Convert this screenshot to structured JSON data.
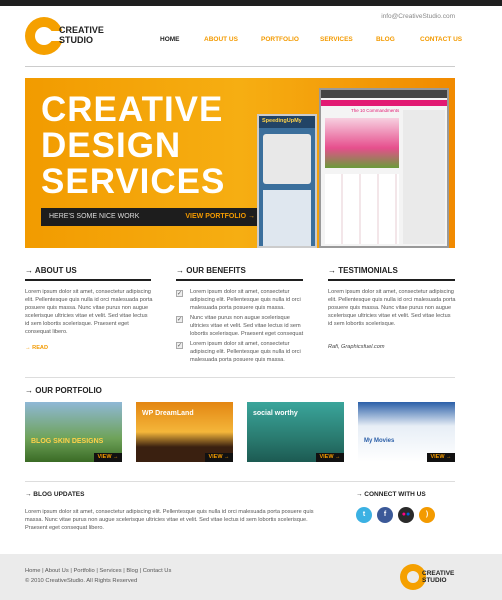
{
  "header": {
    "email": "info@CreativeStudio.com",
    "logo_line1": "CREATIVE",
    "logo_line2": "STUDIO",
    "nav": [
      "HOME",
      "ABOUT US",
      "PORTFOLIO",
      "SERVICES",
      "BLOG",
      "CONTACT US"
    ]
  },
  "hero": {
    "title_line1": "CREATIVE",
    "title_line2": "DESIGN",
    "title_line3": "SERVICES",
    "tagline": "HERE'S SOME NICE WORK",
    "cta": "VIEW PORTFOLIO →",
    "shot1_title": "SpeedingUpMy",
    "shot2_title": "The 10 Commandments"
  },
  "about": {
    "title": "→  ABOUT US",
    "text": "Lorem ipsum dolor sit amet, consectetur adipiscing elit. Pellentesque quis nulla id orci malesuada porta posuere quis massa. Nunc vitae purus non augue scelerisque ultricies vitae et velit. Sed vitae lectus id sem lobortis scelerisque. Praesent eget consequat libero.",
    "read": "→  READ"
  },
  "benefits": {
    "title": "→  OUR BENEFITS",
    "items": [
      "Lorem ipsum dolor sit amet, consectetur adipiscing elit. Pellentesque quis nulla id orci malesuada porta posuere quis massa.",
      "Nunc vitae purus non augue scelerisque ultricies vitae et velit. Sed vitae lectus id sem lobortis scelerisque. Praesent eget consequat",
      "Lorem ipsum dolor sit amet, consectetur adipiscing elit. Pellentesque quis nulla id orci malesuada porta posuere quis massa."
    ]
  },
  "testimonials": {
    "title": "→  TESTIMONIALS",
    "text": "Lorem ipsum dolor sit amet, consectetur adipiscing elit. Pellentesque quis nulla id orci malesuada porta posuere quis massa. Nunc vitae purus non augue scelerisque ultricies vitae et velit. Sed vitae lectus id sem lobortis scelerisque.",
    "author": "Rafi, Graphicsfuel.com"
  },
  "portfolio": {
    "title": "→  OUR PORTFOLIO",
    "view_label": "VIEW →",
    "labels": [
      "BLOG SKIN DESIGNS",
      "WP DreamLand",
      "social worthy",
      "My Movies"
    ]
  },
  "blog_updates": {
    "title": "→  BLOG UPDATES",
    "text": "Lorem ipsum dolor sit amet, consectetur adipiscing elit. Pellentesque quis nulla id orci malesuada porta posuere quis massa. Nunc vitae purus non augue scelerisque ultricies vitae et velit. Sed vitae lectus id sem lobortis scelerisque. Praesent eget consequat libero."
  },
  "connect": {
    "title": "→  CONNECT WITH US",
    "icons": [
      "twitter-icon",
      "facebook-icon",
      "flickr-icon",
      "rss-icon"
    ]
  },
  "footer": {
    "links": "Home  |  About Us  |  Portfolio  |  Services  |  Blog  |  Contact Us",
    "copyright": "© 2010 CreativeStudio. All Rights Reserved",
    "logo_line1": "CREATIVE",
    "logo_line2": "STUDIO"
  },
  "colors": {
    "accent": "#f39a00",
    "dark": "#1f1f1f"
  }
}
